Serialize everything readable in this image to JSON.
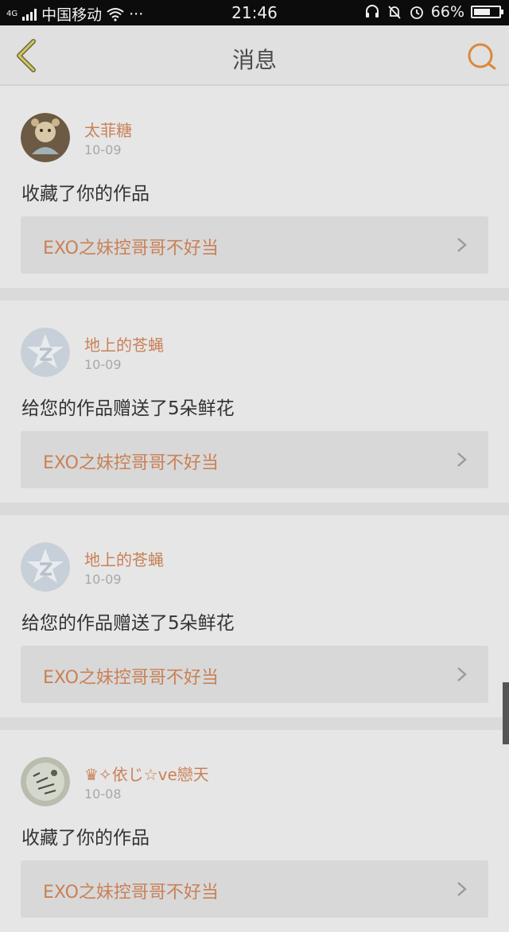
{
  "status_bar": {
    "network": "4G",
    "carrier": "中国移动",
    "more": "···",
    "time": "21:46",
    "battery": "66%",
    "battery_level": 0.66,
    "icons": [
      "headset-icon",
      "bell-muted-icon",
      "alarm-icon",
      "wifi-icon"
    ]
  },
  "header": {
    "title": "消息",
    "back_icon": "chevron-left-icon",
    "search_icon": "search-icon",
    "accent": "#d88a3a"
  },
  "messages": [
    {
      "user": "太菲糖",
      "date": "10-09",
      "action": "收藏了你的作品",
      "work_title": "EXO之妹控哥哥不好当",
      "avatar": "photo"
    },
    {
      "user": "地上的苍蝇",
      "date": "10-09",
      "action": "给您的作品赠送了5朵鲜花",
      "work_title": "EXO之妹控哥哥不好当",
      "avatar": "default"
    },
    {
      "user": "地上的苍蝇",
      "date": "10-09",
      "action": "给您的作品赠送了5朵鲜花",
      "work_title": "EXO之妹控哥哥不好当",
      "avatar": "default"
    },
    {
      "user": "♛✧依じ☆ve戀天",
      "date": "10-08",
      "action": "收藏了你的作品",
      "work_title": "EXO之妹控哥哥不好当",
      "avatar": "photo2"
    }
  ]
}
